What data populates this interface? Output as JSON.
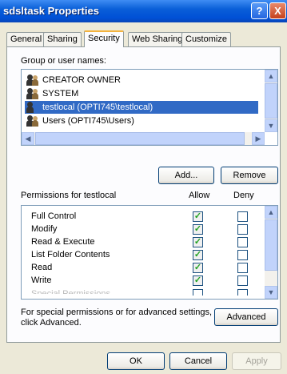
{
  "window": {
    "title": "sdsltask Properties",
    "help_label": "?",
    "close_label": "X"
  },
  "tabs": [
    {
      "label": "General"
    },
    {
      "label": "Sharing"
    },
    {
      "label": "Security",
      "active": true
    },
    {
      "label": "Web Sharing"
    },
    {
      "label": "Customize"
    }
  ],
  "groups": {
    "label": "Group or user names:",
    "items": [
      {
        "label": "CREATOR OWNER"
      },
      {
        "label": "SYSTEM"
      },
      {
        "label": "testlocal (OPTI745\\testlocal)",
        "selected": true
      },
      {
        "label": "Users (OPTI745\\Users)"
      }
    ]
  },
  "buttons": {
    "add": "Add...",
    "remove": "Remove",
    "advanced": "Advanced",
    "ok": "OK",
    "cancel": "Cancel",
    "apply": "Apply"
  },
  "permissions": {
    "label": "Permissions for testlocal",
    "allow_header": "Allow",
    "deny_header": "Deny",
    "rows": [
      {
        "label": "Full Control",
        "allow": true,
        "deny": false
      },
      {
        "label": "Modify",
        "allow": true,
        "deny": false
      },
      {
        "label": "Read & Execute",
        "allow": true,
        "deny": false
      },
      {
        "label": "List Folder Contents",
        "allow": true,
        "deny": false
      },
      {
        "label": "Read",
        "allow": true,
        "deny": false
      },
      {
        "label": "Write",
        "allow": true,
        "deny": false
      },
      {
        "label": "Special Permissions",
        "allow": false,
        "deny": false
      }
    ]
  },
  "advanced_note": {
    "line1": "For special permissions or for advanced settings,",
    "line2": "click Advanced."
  }
}
